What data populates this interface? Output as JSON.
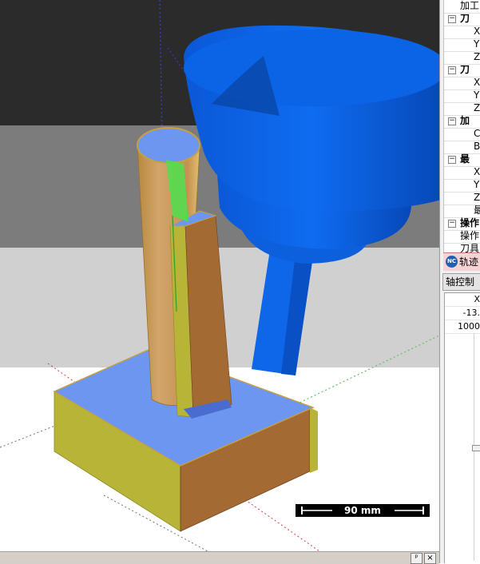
{
  "viewport": {
    "name": "3d-machining-simulation",
    "scale_label": "90 mm",
    "colors": {
      "background_top": "#2b2b2b",
      "background_mid": "#7c7c7c",
      "background_low": "#d0d0d0",
      "floor": "#ffffff",
      "tool_blue": "#0b63e0",
      "stock_top": "#6c96f0",
      "stock_side_yellow": "#b8b438",
      "stock_side_orange": "#a36a34",
      "part_tan": "#c99a62",
      "toolpath_green": "#4ee04e"
    }
  },
  "window_buttons": {
    "pin": "ᵖ",
    "close": "×"
  },
  "tree": {
    "rows": [
      {
        "kind": "item",
        "label": "加工"
      },
      {
        "kind": "section",
        "label": "刀"
      },
      {
        "kind": "item",
        "label": "X"
      },
      {
        "kind": "item",
        "label": "Y"
      },
      {
        "kind": "item",
        "label": "Z"
      },
      {
        "kind": "section",
        "label": "刀"
      },
      {
        "kind": "item",
        "label": "X"
      },
      {
        "kind": "item",
        "label": "Y"
      },
      {
        "kind": "item",
        "label": "Z"
      },
      {
        "kind": "section",
        "label": "加"
      },
      {
        "kind": "item",
        "label": "C"
      },
      {
        "kind": "item",
        "label": "B"
      },
      {
        "kind": "section",
        "label": "最"
      },
      {
        "kind": "item",
        "label": "X"
      },
      {
        "kind": "item",
        "label": "Y"
      },
      {
        "kind": "item",
        "label": "Z"
      },
      {
        "kind": "item",
        "label": "最"
      },
      {
        "kind": "section",
        "label": "操作"
      },
      {
        "kind": "item",
        "label": "操作"
      },
      {
        "kind": "item",
        "label": "刀具"
      }
    ],
    "expander": "−"
  },
  "track_tab": {
    "icon_text": "NC",
    "label": "轨迹"
  },
  "axis_panel": {
    "button_label": "轴控制",
    "header": "X",
    "value": "-13.",
    "rate": "1000"
  }
}
